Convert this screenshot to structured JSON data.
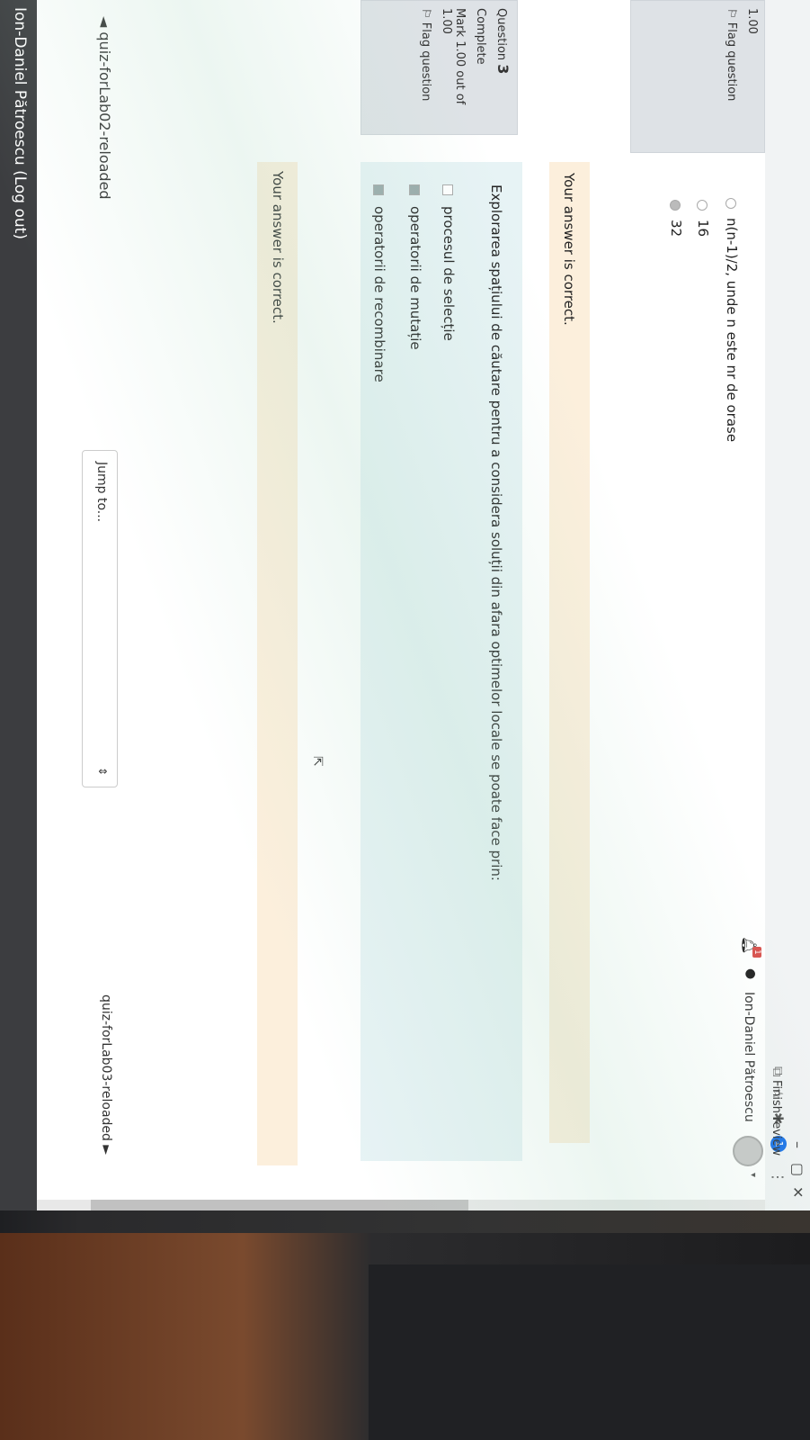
{
  "user": {
    "name": "Ion-Daniel Pătroescu",
    "notification_count": "1",
    "profile_badge": "1"
  },
  "prev_question": {
    "mark": "1.00",
    "flag_label": "Flag question",
    "options": [
      "n(n-1)/2, unde n este nr de orase",
      "16",
      "32"
    ],
    "feedback": "Your answer is correct."
  },
  "question3": {
    "label": "Question",
    "number": "3",
    "status": "Complete",
    "mark": "Mark 1.00 out of 1.00",
    "flag_label": "Flag question",
    "text": "Explorarea spațiului de căutare pentru a considera soluții din afara optimelor locale se poate face prin:",
    "options": [
      "procesul de selecție",
      "operatorii de mutație",
      "operatorii de recombinare"
    ],
    "feedback": "Your answer is correct."
  },
  "navigation": {
    "finish_review": "Finish review",
    "prev_link": "◄ quiz-forLab02-reloaded",
    "jump_placeholder": "Jump to...",
    "next_link": "quiz-forLab03-reloaded ►"
  },
  "footer": {
    "logout": "Ion-Daniel Pătroescu (Log out)"
  },
  "icons": {
    "bookmark": "bookmark-icon",
    "star": "star-icon",
    "extension": "extension-icon",
    "menu": "menu-icon",
    "bell": "bell-icon",
    "chat": "chat-icon",
    "flag": "flag-icon"
  },
  "colors": {
    "info_box": "#dee2e6",
    "feedback_bg": "#fcefdc",
    "question_bg": "#e7f3f5",
    "footer_bg": "#3c3d40",
    "notification_badge": "#d9534f",
    "profile_badge": "#1a73e8"
  }
}
